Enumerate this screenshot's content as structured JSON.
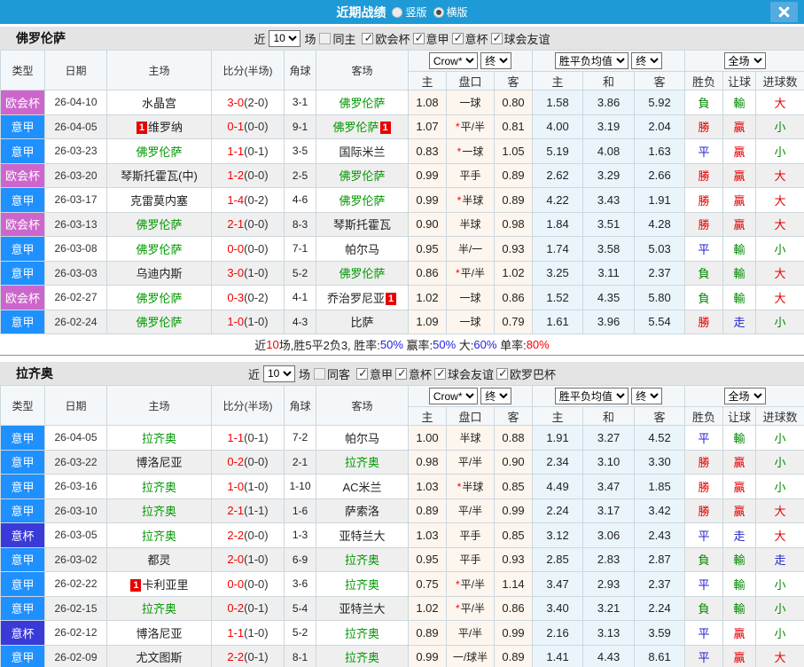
{
  "titlebar": {
    "title": "近期战绩",
    "orientation_options": [
      {
        "label": "竖版",
        "selected": false
      },
      {
        "label": "横版",
        "selected": true
      }
    ]
  },
  "table_header": {
    "static_columns": [
      "类型",
      "日期",
      "主场",
      "比分(半场)",
      "角球",
      "客场"
    ],
    "odds_group": {
      "selects": [
        "Crow*",
        "终"
      ],
      "columns": [
        "主",
        "盘口",
        "客"
      ]
    },
    "avg_group": {
      "selects": [
        "胜平负均值",
        "终"
      ],
      "columns": [
        "主",
        "和",
        "客"
      ]
    },
    "result_group": {
      "selects": [
        "全场"
      ],
      "columns": [
        "胜负",
        "让球",
        "进球数"
      ]
    }
  },
  "colors": {
    "topbar": "#1e9ad6",
    "close_button": "#55aadf",
    "focus_team": "#009900",
    "score": "#f50000",
    "win": "#e60000",
    "draw": "#2222cc",
    "lose": "#008800",
    "odds_bg": "#fdf6ee",
    "avg_bg": "#e9f4fb"
  },
  "type_badge_colors": {
    "欧会杯": "#cc66cc",
    "意甲": "#1e90ff",
    "意杯": "#3a3ad8"
  },
  "result_color_map": {
    "勝": "w",
    "贏": "w",
    "大": "w",
    "平": "d",
    "走": "d",
    "負": "l",
    "輸": "l",
    "小": "l"
  },
  "sections": [
    {
      "team": "佛罗伦萨",
      "filter": {
        "near_label": "近",
        "count": "10",
        "games_label": "场",
        "same_label": "同主",
        "same_checked": false,
        "competitions": [
          {
            "label": "欧会杯",
            "checked": true
          },
          {
            "label": "意甲",
            "checked": true
          },
          {
            "label": "意杯",
            "checked": true
          },
          {
            "label": "球会友谊",
            "checked": true
          }
        ]
      },
      "rows": [
        {
          "type": "欧会杯",
          "date": "26-04-10",
          "home": {
            "name": "水晶宫"
          },
          "score_ft": "3-0",
          "score_ht": "(2-0)",
          "corners": "3-1",
          "away": {
            "name": "佛罗伦萨",
            "focus": true
          },
          "odds": [
            "1.08",
            "一球",
            "0.80"
          ],
          "avg": [
            "1.58",
            "3.86",
            "5.92"
          ],
          "results": [
            "負",
            "輸",
            "大"
          ]
        },
        {
          "type": "意甲",
          "date": "26-04-05",
          "home": {
            "name": "维罗纳",
            "card_before": "1"
          },
          "score_ft": "0-1",
          "score_ht": "(0-0)",
          "corners": "9-1",
          "away": {
            "name": "佛罗伦萨",
            "focus": true,
            "card_after": "1"
          },
          "odds": [
            "1.07",
            "*平/半",
            "0.81"
          ],
          "avg": [
            "4.00",
            "3.19",
            "2.04"
          ],
          "results": [
            "勝",
            "贏",
            "小"
          ]
        },
        {
          "type": "意甲",
          "date": "26-03-23",
          "home": {
            "name": "佛罗伦萨",
            "focus": true
          },
          "score_ft": "1-1",
          "score_ht": "(0-1)",
          "corners": "3-5",
          "away": {
            "name": "国际米兰"
          },
          "odds": [
            "0.83",
            "*一球",
            "1.05"
          ],
          "avg": [
            "5.19",
            "4.08",
            "1.63"
          ],
          "results": [
            "平",
            "贏",
            "小"
          ]
        },
        {
          "type": "欧会杯",
          "date": "26-03-20",
          "home": {
            "name": "琴斯托霍瓦(中)"
          },
          "score_ft": "1-2",
          "score_ht": "(0-0)",
          "corners": "2-5",
          "away": {
            "name": "佛罗伦萨",
            "focus": true
          },
          "odds": [
            "0.99",
            "平手",
            "0.89"
          ],
          "avg": [
            "2.62",
            "3.29",
            "2.66"
          ],
          "results": [
            "勝",
            "贏",
            "大"
          ]
        },
        {
          "type": "意甲",
          "date": "26-03-17",
          "home": {
            "name": "克雷莫内塞"
          },
          "score_ft": "1-4",
          "score_ht": "(0-2)",
          "corners": "4-6",
          "away": {
            "name": "佛罗伦萨",
            "focus": true
          },
          "odds": [
            "0.99",
            "*半球",
            "0.89"
          ],
          "avg": [
            "4.22",
            "3.43",
            "1.91"
          ],
          "results": [
            "勝",
            "贏",
            "大"
          ]
        },
        {
          "type": "欧会杯",
          "date": "26-03-13",
          "home": {
            "name": "佛罗伦萨",
            "focus": true
          },
          "score_ft": "2-1",
          "score_ht": "(0-0)",
          "corners": "8-3",
          "away": {
            "name": "琴斯托霍瓦"
          },
          "odds": [
            "0.90",
            "半球",
            "0.98"
          ],
          "avg": [
            "1.84",
            "3.51",
            "4.28"
          ],
          "results": [
            "勝",
            "贏",
            "大"
          ]
        },
        {
          "type": "意甲",
          "date": "26-03-08",
          "home": {
            "name": "佛罗伦萨",
            "focus": true
          },
          "score_ft": "0-0",
          "score_ht": "(0-0)",
          "corners": "7-1",
          "away": {
            "name": "帕尔马"
          },
          "odds": [
            "0.95",
            "半/一",
            "0.93"
          ],
          "avg": [
            "1.74",
            "3.58",
            "5.03"
          ],
          "results": [
            "平",
            "輸",
            "小"
          ]
        },
        {
          "type": "意甲",
          "date": "26-03-03",
          "home": {
            "name": "乌迪内斯"
          },
          "score_ft": "3-0",
          "score_ht": "(1-0)",
          "corners": "5-2",
          "away": {
            "name": "佛罗伦萨",
            "focus": true
          },
          "odds": [
            "0.86",
            "*平/半",
            "1.02"
          ],
          "avg": [
            "3.25",
            "3.11",
            "2.37"
          ],
          "results": [
            "負",
            "輸",
            "大"
          ]
        },
        {
          "type": "欧会杯",
          "date": "26-02-27",
          "home": {
            "name": "佛罗伦萨",
            "focus": true
          },
          "score_ft": "0-3",
          "score_ht": "(0-2)",
          "corners": "4-1",
          "away": {
            "name": "乔治罗尼亚",
            "card_after": "1"
          },
          "odds": [
            "1.02",
            "一球",
            "0.86"
          ],
          "avg": [
            "1.52",
            "4.35",
            "5.80"
          ],
          "results": [
            "負",
            "輸",
            "大"
          ]
        },
        {
          "type": "意甲",
          "date": "26-02-24",
          "home": {
            "name": "佛罗伦萨",
            "focus": true
          },
          "score_ft": "1-0",
          "score_ht": "(1-0)",
          "corners": "4-3",
          "away": {
            "name": "比萨"
          },
          "odds": [
            "1.09",
            "一球",
            "0.79"
          ],
          "avg": [
            "1.61",
            "3.96",
            "5.54"
          ],
          "results": [
            "勝",
            "走",
            "小"
          ]
        }
      ],
      "summary": [
        {
          "t": "近",
          "c": "k"
        },
        {
          "t": "10",
          "c": "r"
        },
        {
          "t": "场,胜5平2负3, 胜率:",
          "c": "k"
        },
        {
          "t": "50%",
          "c": "b"
        },
        {
          "t": " 赢率:",
          "c": "k"
        },
        {
          "t": "50%",
          "c": "b"
        },
        {
          "t": " 大:",
          "c": "k"
        },
        {
          "t": "60%",
          "c": "b"
        },
        {
          "t": " 单率:",
          "c": "k"
        },
        {
          "t": "80%",
          "c": "r"
        }
      ]
    },
    {
      "team": "拉齐奥",
      "filter": {
        "near_label": "近",
        "count": "10",
        "games_label": "场",
        "same_label": "同客",
        "same_checked": false,
        "competitions": [
          {
            "label": "意甲",
            "checked": true
          },
          {
            "label": "意杯",
            "checked": true
          },
          {
            "label": "球会友谊",
            "checked": true
          },
          {
            "label": "欧罗巴杯",
            "checked": true
          }
        ]
      },
      "rows": [
        {
          "type": "意甲",
          "date": "26-04-05",
          "home": {
            "name": "拉齐奥",
            "focus": true
          },
          "score_ft": "1-1",
          "score_ht": "(0-1)",
          "corners": "7-2",
          "away": {
            "name": "帕尔马"
          },
          "odds": [
            "1.00",
            "半球",
            "0.88"
          ],
          "avg": [
            "1.91",
            "3.27",
            "4.52"
          ],
          "results": [
            "平",
            "輸",
            "小"
          ]
        },
        {
          "type": "意甲",
          "date": "26-03-22",
          "home": {
            "name": "博洛尼亚"
          },
          "score_ft": "0-2",
          "score_ht": "(0-0)",
          "corners": "2-1",
          "away": {
            "name": "拉齐奥",
            "focus": true
          },
          "odds": [
            "0.98",
            "平/半",
            "0.90"
          ],
          "avg": [
            "2.34",
            "3.10",
            "3.30"
          ],
          "results": [
            "勝",
            "贏",
            "小"
          ]
        },
        {
          "type": "意甲",
          "date": "26-03-16",
          "home": {
            "name": "拉齐奥",
            "focus": true
          },
          "score_ft": "1-0",
          "score_ht": "(1-0)",
          "corners": "1-10",
          "away": {
            "name": "AC米兰"
          },
          "odds": [
            "1.03",
            "*半球",
            "0.85"
          ],
          "avg": [
            "4.49",
            "3.47",
            "1.85"
          ],
          "results": [
            "勝",
            "贏",
            "小"
          ]
        },
        {
          "type": "意甲",
          "date": "26-03-10",
          "home": {
            "name": "拉齐奥",
            "focus": true
          },
          "score_ft": "2-1",
          "score_ht": "(1-1)",
          "corners": "1-6",
          "away": {
            "name": "萨索洛"
          },
          "odds": [
            "0.89",
            "平/半",
            "0.99"
          ],
          "avg": [
            "2.24",
            "3.17",
            "3.42"
          ],
          "results": [
            "勝",
            "贏",
            "大"
          ]
        },
        {
          "type": "意杯",
          "date": "26-03-05",
          "home": {
            "name": "拉齐奥",
            "focus": true
          },
          "score_ft": "2-2",
          "score_ht": "(0-0)",
          "corners": "1-3",
          "away": {
            "name": "亚特兰大"
          },
          "odds": [
            "1.03",
            "平手",
            "0.85"
          ],
          "avg": [
            "3.12",
            "3.06",
            "2.43"
          ],
          "results": [
            "平",
            "走",
            "大"
          ]
        },
        {
          "type": "意甲",
          "date": "26-03-02",
          "home": {
            "name": "都灵"
          },
          "score_ft": "2-0",
          "score_ht": "(1-0)",
          "corners": "6-9",
          "away": {
            "name": "拉齐奥",
            "focus": true
          },
          "odds": [
            "0.95",
            "平手",
            "0.93"
          ],
          "avg": [
            "2.85",
            "2.83",
            "2.87"
          ],
          "results": [
            "負",
            "輸",
            "走"
          ]
        },
        {
          "type": "意甲",
          "date": "26-02-22",
          "home": {
            "name": "卡利亚里",
            "card_before": "1"
          },
          "score_ft": "0-0",
          "score_ht": "(0-0)",
          "corners": "3-6",
          "away": {
            "name": "拉齐奥",
            "focus": true
          },
          "odds": [
            "0.75",
            "*平/半",
            "1.14"
          ],
          "avg": [
            "3.47",
            "2.93",
            "2.37"
          ],
          "results": [
            "平",
            "輸",
            "小"
          ]
        },
        {
          "type": "意甲",
          "date": "26-02-15",
          "home": {
            "name": "拉齐奥",
            "focus": true
          },
          "score_ft": "0-2",
          "score_ht": "(0-1)",
          "corners": "5-4",
          "away": {
            "name": "亚特兰大"
          },
          "odds": [
            "1.02",
            "*平/半",
            "0.86"
          ],
          "avg": [
            "3.40",
            "3.21",
            "2.24"
          ],
          "results": [
            "負",
            "輸",
            "小"
          ]
        },
        {
          "type": "意杯",
          "date": "26-02-12",
          "home": {
            "name": "博洛尼亚"
          },
          "score_ft": "1-1",
          "score_ht": "(1-0)",
          "corners": "5-2",
          "away": {
            "name": "拉齐奥",
            "focus": true
          },
          "odds": [
            "0.89",
            "平/半",
            "0.99"
          ],
          "avg": [
            "2.16",
            "3.13",
            "3.59"
          ],
          "results": [
            "平",
            "贏",
            "小"
          ]
        },
        {
          "type": "意甲",
          "date": "26-02-09",
          "home": {
            "name": "尤文图斯"
          },
          "score_ft": "2-2",
          "score_ht": "(0-1)",
          "corners": "8-1",
          "away": {
            "name": "拉齐奥",
            "focus": true
          },
          "odds": [
            "0.99",
            "一/球半",
            "0.89"
          ],
          "avg": [
            "1.41",
            "4.43",
            "8.61"
          ],
          "results": [
            "平",
            "贏",
            "大"
          ]
        }
      ],
      "summary": null
    }
  ]
}
